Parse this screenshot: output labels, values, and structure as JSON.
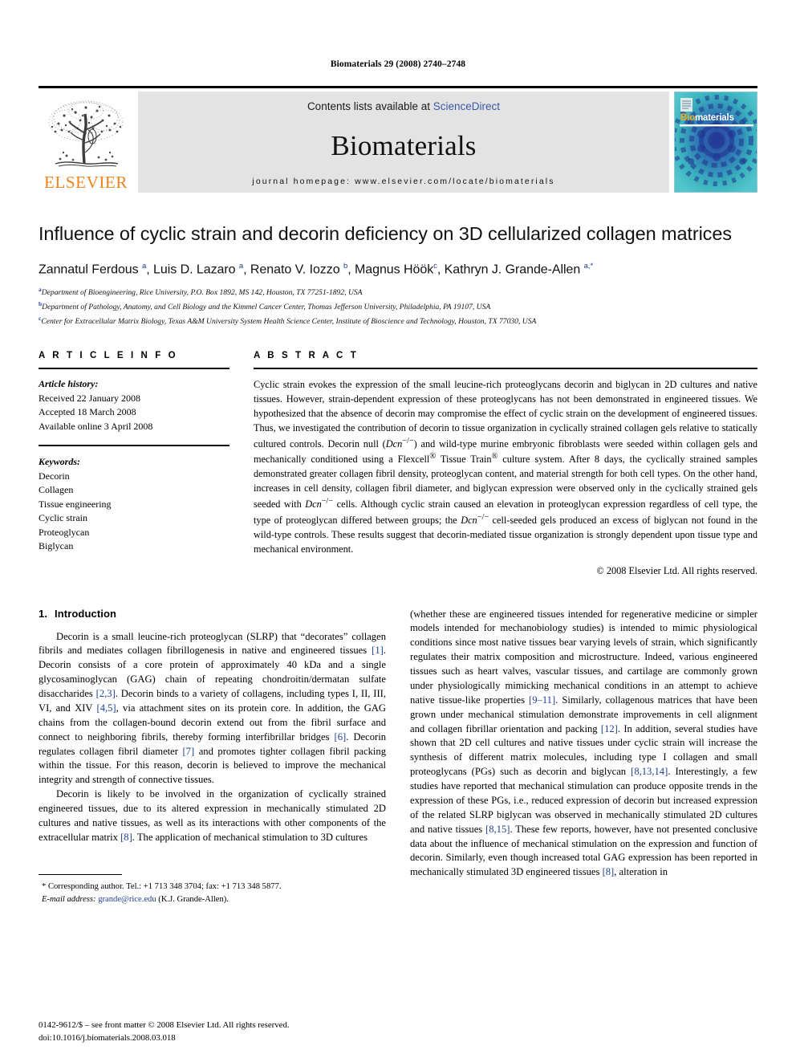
{
  "running_head": "Biomaterials 29 (2008) 2740–2748",
  "masthead": {
    "contents_prefix": "Contents lists available at ",
    "sciencedirect": "ScienceDirect",
    "journal_name": "Biomaterials",
    "homepage": "journal homepage: www.elsevier.com/locate/biomaterials",
    "publisher_wordmark": "ELSEVIER",
    "cover_title_bio": "Bio",
    "cover_title_materials": "materials"
  },
  "article": {
    "title": "Influence of cyclic strain and decorin deficiency on 3D cellularized collagen matrices",
    "authors_html": "Zannatul Ferdous <sup>a</sup>, Luis D. Lazaro <sup>a</sup>, Renato V. Iozzo <sup>b</sup>, Magnus Höök<sup>c</sup>, Kathryn J. Grande-Allen <sup>a,</sup><sup>*</sup>",
    "affiliations": [
      {
        "marker": "a",
        "text": "Department of Bioengineering, Rice University, P.O. Box 1892, MS 142, Houston, TX 77251-1892, USA"
      },
      {
        "marker": "b",
        "text": "Department of Pathology, Anatomy, and Cell Biology and the Kimmel Cancer Center, Thomas Jefferson University, Philadelphia, PA 19107, USA"
      },
      {
        "marker": "c",
        "text": "Center for Extracellular Matrix Biology, Texas A&M University System Health Science Center, Institute of Bioscience and Technology, Houston, TX 77030, USA"
      }
    ]
  },
  "article_info": {
    "heading": "A R T I C L E  I N F O",
    "history_label": "Article history:",
    "history": [
      "Received 22 January 2008",
      "Accepted 18 March 2008",
      "Available online 3 April 2008"
    ],
    "keywords_label": "Keywords:",
    "keywords": [
      "Decorin",
      "Collagen",
      "Tissue engineering",
      "Cyclic strain",
      "Proteoglycan",
      "Biglycan"
    ]
  },
  "abstract": {
    "heading": "A B S T R A C T",
    "text_html": "Cyclic strain evokes the expression of the small leucine-rich proteoglycans decorin and biglycan in 2D cultures and native tissues. However, strain-dependent expression of these proteoglycans has not been demonstrated in engineered tissues. We hypothesized that the absence of decorin may compromise the effect of cyclic strain on the development of engineered tissues. Thus, we investigated the contribution of decorin to tissue organization in cyclically strained collagen gels relative to statically cultured controls. Decorin null (<i>Dcn</i><sup>&minus;/&minus;</sup>) and wild-type murine embryonic fibroblasts were seeded within collagen gels and mechanically conditioned using a Flexcell<sup>&reg;</sup> Tissue Train<sup>&reg;</sup> culture system. After 8 days, the cyclically strained samples demonstrated greater collagen fibril density, proteoglycan content, and material strength for both cell types. On the other hand, increases in cell density, collagen fibril diameter, and biglycan expression were observed only in the cyclically strained gels seeded with <i>Dcn</i><sup>&minus;/&minus;</sup> cells. Although cyclic strain caused an elevation in proteoglycan expression regardless of cell type, the type of proteoglycan differed between groups; the <i>Dcn</i><sup>&minus;/&minus;</sup> cell-seeded gels produced an excess of biglycan not found in the wild-type controls. These results suggest that decorin-mediated tissue organization is strongly dependent upon tissue type and mechanical environment.",
    "copyright": "© 2008 Elsevier Ltd. All rights reserved."
  },
  "introduction": {
    "number": "1.",
    "heading": "Introduction",
    "left_paragraphs_html": [
      "Decorin is a small leucine-rich proteoglycan (SLRP) that &ldquo;decorates&rdquo; collagen fibrils and mediates collagen fibrillogenesis in native and engineered tissues <span class=\"ref\">[1]</span>. Decorin consists of a core protein of approximately 40 kDa and a single glycosaminoglycan (GAG) chain of repeating chondroitin/dermatan sulfate disaccharides <span class=\"ref\">[2,3]</span>. Decorin binds to a variety of collagens, including types I, II, III, VI, and XIV <span class=\"ref\">[4,5]</span>, via attachment sites on its protein core. In addition, the GAG chains from the collagen-bound decorin extend out from the fibril surface and connect to neighboring fibrils, thereby forming interfibrillar bridges <span class=\"ref\">[6]</span>. Decorin regulates collagen fibril diameter <span class=\"ref\">[7]</span> and promotes tighter collagen fibril packing within the tissue. For this reason, decorin is believed to improve the mechanical integrity and strength of connective tissues.",
      "Decorin is likely to be involved in the organization of cyclically strained engineered tissues, due to its altered expression in mechanically stimulated 2D cultures and native tissues, as well as its interactions with other components of the extracellular matrix <span class=\"ref\">[8]</span>. The application of mechanical stimulation to 3D cultures"
    ],
    "right_paragraphs_html": [
      "(whether these are engineered tissues intended for regenerative medicine or simpler models intended for mechanobiology studies) is intended to mimic physiological conditions since most native tissues bear varying levels of strain, which significantly regulates their matrix composition and microstructure. Indeed, various engineered tissues such as heart valves, vascular tissues, and cartilage are commonly grown under physiologically mimicking mechanical conditions in an attempt to achieve native tissue-like properties <span class=\"ref\">[9&ndash;11]</span>. Similarly, collagenous matrices that have been grown under mechanical stimulation demonstrate improvements in cell alignment and collagen fibrillar orientation and packing <span class=\"ref\">[12]</span>. In addition, several studies have shown that 2D cell cultures and native tissues under cyclic strain will increase the synthesis of different matrix molecules, including type I collagen and small proteoglycans (PGs) such as decorin and biglycan <span class=\"ref\">[8,13,14]</span>. Interestingly, a few studies have reported that mechanical stimulation can produce opposite trends in the expression of these PGs, i.e., reduced expression of decorin but increased expression of the related SLRP biglycan was observed in mechanically stimulated 2D cultures and native tissues <span class=\"ref\">[8,15]</span>. These few reports, however, have not presented conclusive data about the influence of mechanical stimulation on the expression and function of decorin. Similarly, even though increased total GAG expression has been reported in mechanically stimulated 3D engineered tissues <span class=\"ref\">[8]</span>, alteration in"
    ]
  },
  "footnotes": {
    "corresponding_html": "* Corresponding author. Tel.: +1 713 348 3704; fax: +1 713 348 5877.",
    "email_label": "E-mail address:",
    "email": "grande@rice.edu",
    "email_suffix": "(K.J. Grande-Allen)."
  },
  "imprint": {
    "line1": "0142-9612/$ – see front matter © 2008 Elsevier Ltd. All rights reserved.",
    "line2": "doi:10.1016/j.biomaterials.2008.03.018"
  },
  "colors": {
    "link_blue": "#3b57a8",
    "ref_blue": "#1c3f94",
    "elsevier_orange": "#F0821E",
    "masthead_gray": "#e3e3e3",
    "cover_teal": "#2aa7b5"
  }
}
